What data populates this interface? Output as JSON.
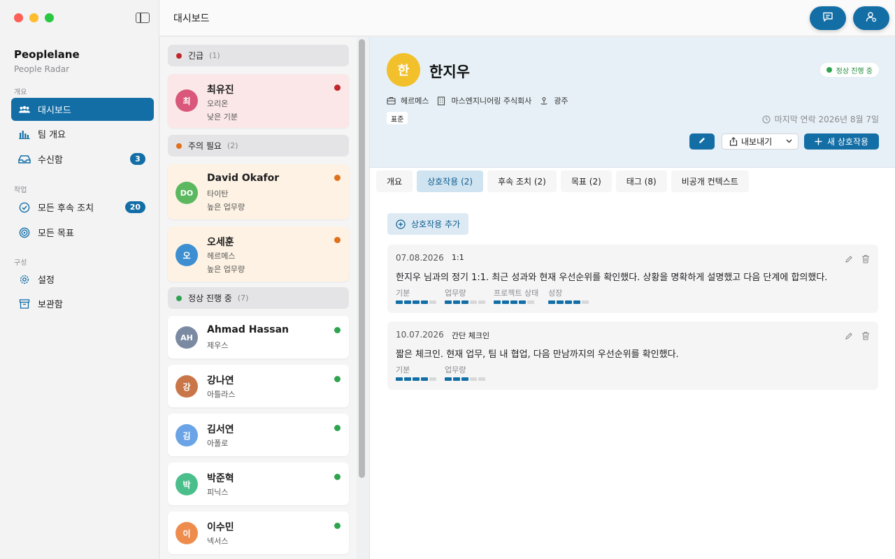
{
  "app": {
    "name": "Peoplelane",
    "subtitle": "People Radar"
  },
  "sidebar": {
    "sections": [
      {
        "label": "개요"
      },
      {
        "label": "작업"
      },
      {
        "label": "구성"
      }
    ],
    "items": [
      {
        "label": "대시보드",
        "icon": "people-icon",
        "active": true
      },
      {
        "label": "팀 개요",
        "icon": "bar-chart-icon"
      },
      {
        "label": "수신함",
        "icon": "inbox-icon",
        "badge": "3"
      },
      {
        "label": "모든 후속 조치",
        "icon": "check-circle-icon",
        "badge": "20"
      },
      {
        "label": "모든 목표",
        "icon": "target-icon"
      },
      {
        "label": "설정",
        "icon": "gear-icon"
      },
      {
        "label": "보관함",
        "icon": "archive-icon"
      }
    ]
  },
  "topbar": {
    "title": "대시보드"
  },
  "groups": [
    {
      "label": "긴급",
      "count": "(1)",
      "color": "#c1262c"
    },
    {
      "label": "주의 필요",
      "count": "(2)",
      "color": "#e0701c"
    },
    {
      "label": "정상 진행 중",
      "count": "(7)",
      "color": "#2ea44f"
    }
  ],
  "people": [
    {
      "initials": "최",
      "name": "최유진",
      "team": "오리온",
      "note": "낮은 기분",
      "avatar_color": "#d9577a",
      "status_color": "#c1262c"
    },
    {
      "initials": "DO",
      "name": "David Okafor",
      "team": "타이탄",
      "note": "높은 업무량",
      "avatar_color": "#5bb85f",
      "status_color": "#e0701c"
    },
    {
      "initials": "오",
      "name": "오세훈",
      "team": "헤르메스",
      "note": "높은 업무량",
      "avatar_color": "#3d8fd1",
      "status_color": "#e0701c"
    },
    {
      "initials": "AH",
      "name": "Ahmad Hassan",
      "team": "제우스",
      "avatar_color": "#7b8aa3",
      "status_color": "#2ea44f"
    },
    {
      "initials": "강",
      "name": "강나연",
      "team": "아틀라스",
      "avatar_color": "#c97649",
      "status_color": "#2ea44f"
    },
    {
      "initials": "김",
      "name": "김서연",
      "team": "아폴로",
      "avatar_color": "#6aa4e6",
      "status_color": "#2ea44f"
    },
    {
      "initials": "박",
      "name": "박준혁",
      "team": "피닉스",
      "avatar_color": "#4bbf8b",
      "status_color": "#2ea44f"
    },
    {
      "initials": "이",
      "name": "이수민",
      "team": "넥서스",
      "avatar_color": "#ee8c4e",
      "status_color": "#2ea44f"
    }
  ],
  "detail": {
    "initials": "한",
    "name": "한지우",
    "status": "정상 진행 중",
    "team": "헤르메스",
    "company": "마스엔지니어링 주식회사",
    "location": "광주",
    "tier": "표준",
    "last_contact": "마지막 연락 2026년 8월 7일",
    "buttons": {
      "export": "내보내기",
      "new_interaction": "새 상호작용"
    },
    "tabs": [
      {
        "label": "개요"
      },
      {
        "label": "상호작용 (2)",
        "active": true
      },
      {
        "label": "후속 조치 (2)"
      },
      {
        "label": "목표 (2)"
      },
      {
        "label": "태그 (8)"
      },
      {
        "label": "비공개 컨텍스트"
      }
    ],
    "add_interaction": "상호작용 추가",
    "interactions": [
      {
        "date": "07.08.2026",
        "type": "1:1",
        "text": "한지우 님과의 정기 1:1. 최근 성과와 현재 우선순위를 확인했다. 상황을 명확하게 설명했고 다음 단계에 합의했다.",
        "metrics": [
          {
            "label": "기분",
            "value": 4,
            "max": 5
          },
          {
            "label": "업무량",
            "value": 3,
            "max": 5
          },
          {
            "label": "프로젝트 상태",
            "value": 4,
            "max": 5
          },
          {
            "label": "성장",
            "value": 4,
            "max": 5
          }
        ]
      },
      {
        "date": "10.07.2026",
        "type": "간단 체크인",
        "text": "짧은 체크인. 현재 업무, 팀 내 협업, 다음 만남까지의 우선순위를 확인했다.",
        "metrics": [
          {
            "label": "기분",
            "value": 4,
            "max": 5
          },
          {
            "label": "업무량",
            "value": 3,
            "max": 5
          }
        ]
      }
    ]
  }
}
